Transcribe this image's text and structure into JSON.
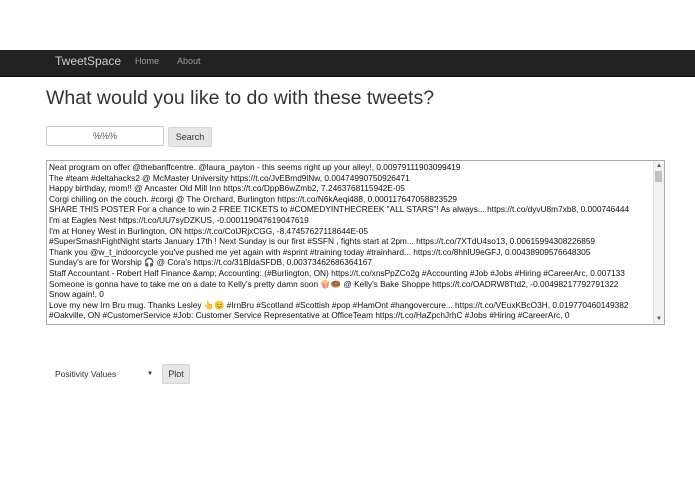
{
  "navbar": {
    "brand": "TweetSpace",
    "links": [
      "Home",
      "About"
    ]
  },
  "page": {
    "heading": "What would you like to do with these tweets?"
  },
  "search": {
    "value": "%%%",
    "button_label": "Search"
  },
  "tweets": [
    "Neat program on offer @thebanffcentre. @laura_payton - this seems right up your alley!, 0.00979111903099419",
    "The #team #deltahacks2 @ McMaster University https://t.co/JvEBmd9lNw, 0.00474990750926471",
    "Happy birthday, mom!! @ Ancaster Old Mill Inn https://t.co/DppB6wZmb2, 7.2463768115942E-05",
    "Corgi chilling on the couch. #corgi @ The Orchard, Burlington https://t.co/N6kAeqi488, 0.000117647058823529",
    "SHARE THIS POSTER For a chance to win 2 FREE TICKETS to #COMEDYINTHECREEK \"ALL STARS\"! As always... https://t.co/dyvU8m7xb8, 0.000746444",
    "I'm at Eagles Nest https://t.co/UU7syDZKUS, -0.000119047619047619",
    "I'm at Honey West in Burlington, ON https://t.co/ColJRjxCGG, -8.47457627118644E-05",
    "#SuperSmashFightNight starts January 17th ! Next Sunday is our first #SSFN , fights start at 2pm... https://t.co/7XTdU4so13, 0.00615994308226859",
    "Thank you @w_t_indoorcycle you've pushed me yet again with #sprint #training today #trainhard... https://t.co/8hhlU9eGFJ, 0.00438909576648305",
    "Sunday's are for Worship 🎧 @ Cora's https://t.co/31BldaSFDB, 0.00373462686364167",
    "Staff Accountant - Robert Half Finance &amp; Accounting: (#Burlington, ON) https://t.co/xnsPpZCo2g #Accounting #Job #Jobs #Hiring #CareerArc, 0.007133",
    "Someone is gonna have to take me on a date to Kelly's pretty damn soon 🍿🍩 @ Kelly's Bake Shoppe https://t.co/OADRW8Ttd2, -0.00498217792791322",
    "Snow again!, 0",
    "Love my new Irn Bru mug. Thanks Lesley 👆😊 #IrnBru #Scotland #Scottish #pop #HamOnt #hangovercure... https://t.co/VEuxKBcO3H, 0.019770460149382",
    "#Oakville, ON #CustomerService #Job: Customer Service Representative at OfficeTeam https://t.co/HaZpchJrhC #Jobs #Hiring #CareerArc, 0"
  ],
  "plot": {
    "selected_option": "Positivity Values",
    "button_label": "Plot"
  }
}
